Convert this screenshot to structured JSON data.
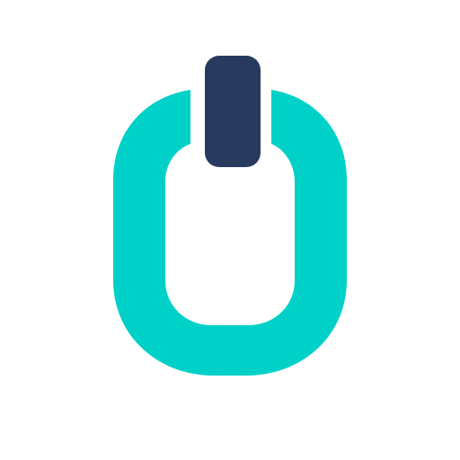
{
  "icon": {
    "name": "power-button-icon",
    "colors": {
      "ring": "#00D1C8",
      "bar": "#283A5E",
      "background": "#FFFFFF"
    }
  }
}
